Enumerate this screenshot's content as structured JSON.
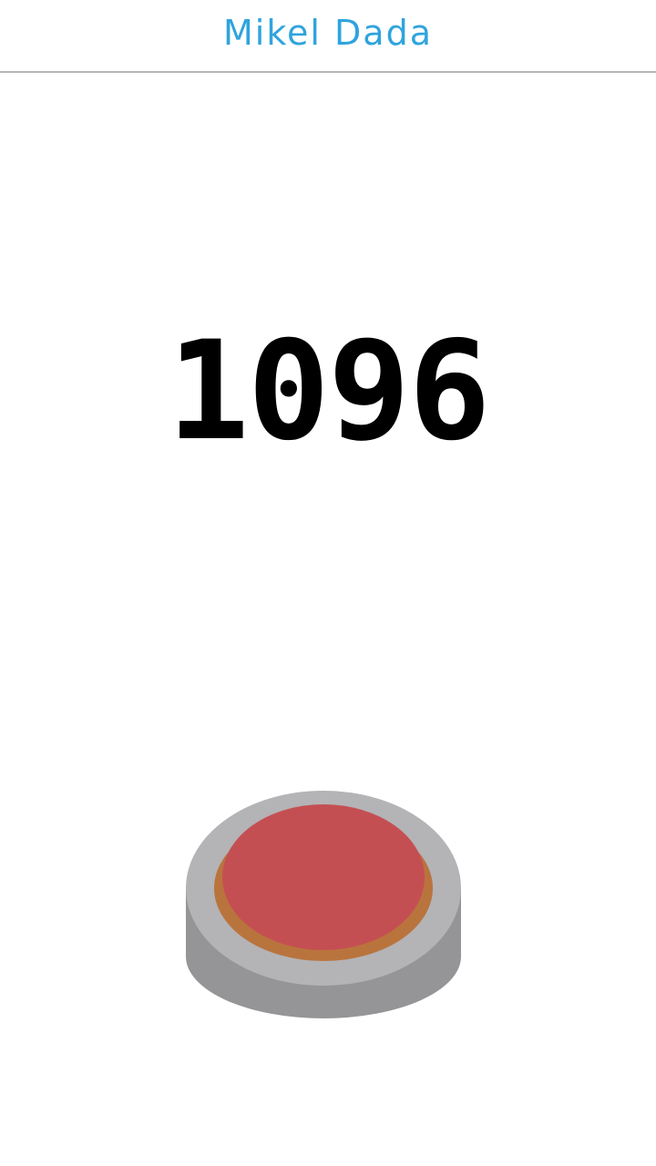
{
  "header": {
    "title": "Mikel Dada"
  },
  "counter": {
    "value": "1096"
  },
  "colors": {
    "title": "#2fa4dd",
    "counter": "#000000",
    "button_base": "#b4b3b6",
    "button_base_side": "#959496",
    "button_cap": "#c44f52",
    "button_cap_edge": "#b8643f",
    "divider": "#b5b5b5"
  },
  "icons": {
    "main_button": "red-push-button"
  }
}
